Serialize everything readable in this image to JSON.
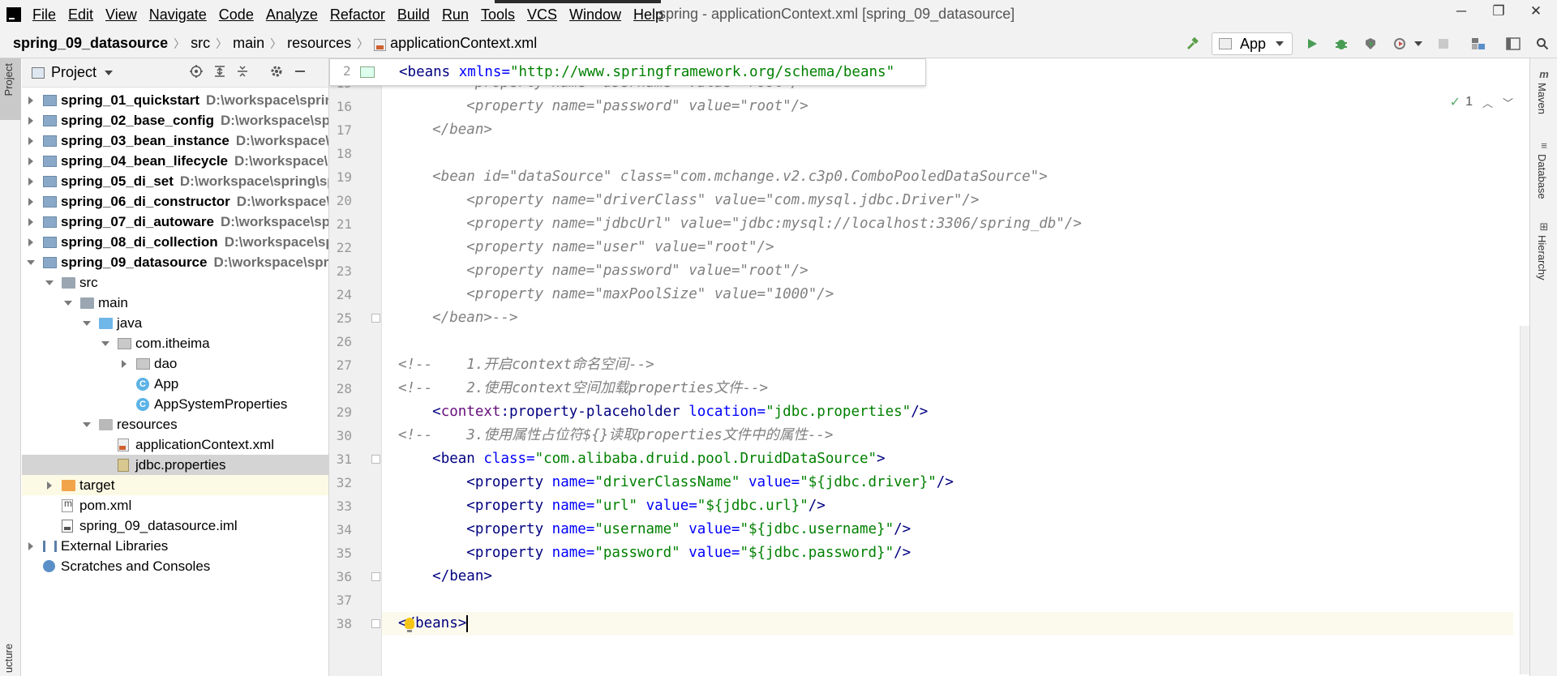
{
  "menu": {
    "items": [
      "File",
      "Edit",
      "View",
      "Navigate",
      "Code",
      "Analyze",
      "Refactor",
      "Build",
      "Run",
      "Tools",
      "VCS",
      "Window",
      "Help"
    ],
    "window_title": "spring - applicationContext.xml [spring_09_datasource]"
  },
  "window_controls": {
    "minimize": "─",
    "restore": "❐",
    "close": "✕"
  },
  "breadcrumb": {
    "items": [
      "spring_09_datasource",
      "src",
      "main",
      "resources",
      "applicationContext.xml"
    ],
    "separator": "〉"
  },
  "toolbar": {
    "run_config": "App",
    "icons": [
      "hammer-icon",
      "run-icon",
      "debug-icon",
      "coverage-icon",
      "profile-icon",
      "stop-icon",
      "project-structure-icon",
      "layout-icon",
      "search-icon"
    ]
  },
  "left_strip": {
    "project": "Project",
    "structure": "ucture"
  },
  "project_panel": {
    "title": "Project",
    "tree": [
      {
        "label": "spring_01_quickstart",
        "path": "D:\\workspace\\sprin",
        "depth": 0,
        "expand": "right",
        "icon": "module",
        "bold": true
      },
      {
        "label": "spring_02_base_config",
        "path": "D:\\workspace\\spri",
        "depth": 0,
        "expand": "right",
        "icon": "module",
        "bold": true
      },
      {
        "label": "spring_03_bean_instance",
        "path": "D:\\workspace\\s",
        "depth": 0,
        "expand": "right",
        "icon": "module",
        "bold": true
      },
      {
        "label": "spring_04_bean_lifecycle",
        "path": "D:\\workspace\\s",
        "depth": 0,
        "expand": "right",
        "icon": "module",
        "bold": true
      },
      {
        "label": "spring_05_di_set",
        "path": "D:\\workspace\\spring\\sp",
        "depth": 0,
        "expand": "right",
        "icon": "module",
        "bold": true
      },
      {
        "label": "spring_06_di_constructor",
        "path": "D:\\workspace\\s",
        "depth": 0,
        "expand": "right",
        "icon": "module",
        "bold": true
      },
      {
        "label": "spring_07_di_autoware",
        "path": "D:\\workspace\\spr",
        "depth": 0,
        "expand": "right",
        "icon": "module",
        "bold": true
      },
      {
        "label": "spring_08_di_collection",
        "path": "D:\\workspace\\sp",
        "depth": 0,
        "expand": "right",
        "icon": "module",
        "bold": true
      },
      {
        "label": "spring_09_datasource",
        "path": "D:\\workspace\\sprin",
        "depth": 0,
        "expand": "down",
        "icon": "module",
        "bold": true
      },
      {
        "label": "src",
        "path": "",
        "depth": 1,
        "expand": "down",
        "icon": "folder",
        "bold": false
      },
      {
        "label": "main",
        "path": "",
        "depth": 2,
        "expand": "down",
        "icon": "folder",
        "bold": false
      },
      {
        "label": "java",
        "path": "",
        "depth": 3,
        "expand": "down",
        "icon": "srcfolder",
        "bold": false
      },
      {
        "label": "com.itheima",
        "path": "",
        "depth": 4,
        "expand": "down",
        "icon": "package",
        "bold": false
      },
      {
        "label": "dao",
        "path": "",
        "depth": 5,
        "expand": "right",
        "icon": "package",
        "bold": false
      },
      {
        "label": "App",
        "path": "",
        "depth": 5,
        "expand": "none",
        "icon": "cls",
        "bold": false
      },
      {
        "label": "AppSystemProperties",
        "path": "",
        "depth": 5,
        "expand": "none",
        "icon": "cls",
        "bold": false
      },
      {
        "label": "resources",
        "path": "",
        "depth": 3,
        "expand": "down",
        "icon": "resfolder",
        "bold": false
      },
      {
        "label": "applicationContext.xml",
        "path": "",
        "depth": 4,
        "expand": "none",
        "icon": "xml",
        "bold": false
      },
      {
        "label": "jdbc.properties",
        "path": "",
        "depth": 4,
        "expand": "none",
        "icon": "props",
        "bold": false,
        "selected": true
      },
      {
        "label": "target",
        "path": "",
        "depth": 1,
        "expand": "right",
        "icon": "orange",
        "bold": false,
        "highlight": true
      },
      {
        "label": "pom.xml",
        "path": "",
        "depth": 1,
        "expand": "none",
        "icon": "maven",
        "bold": false
      },
      {
        "label": "spring_09_datasource.iml",
        "path": "",
        "depth": 1,
        "expand": "none",
        "icon": "iml",
        "bold": false
      },
      {
        "label": "External Libraries",
        "path": "",
        "depth": 0,
        "expand": "right",
        "icon": "libs",
        "bold": false
      },
      {
        "label": "Scratches and Consoles",
        "path": "",
        "depth": 0,
        "expand": "none",
        "icon": "scratch",
        "bold": false
      }
    ]
  },
  "editor": {
    "sticky": {
      "line": "2",
      "tokens": [
        [
          "tag",
          "<beans "
        ],
        [
          "attr",
          "xmlns="
        ],
        [
          "val",
          "\"http://www.springframework.org/schema/beans\""
        ]
      ]
    },
    "inspection": {
      "count": "1"
    },
    "lines": [
      {
        "n": "15",
        "tokens": [
          [
            "cmt",
            "        <property name=\"username\" value=\"root\"/>"
          ]
        ]
      },
      {
        "n": "16",
        "tokens": [
          [
            "cmt",
            "        <property name=\"password\" value=\"root\"/>"
          ]
        ]
      },
      {
        "n": "17",
        "tokens": [
          [
            "cmt",
            "    </bean>"
          ]
        ]
      },
      {
        "n": "18",
        "tokens": []
      },
      {
        "n": "19",
        "tokens": [
          [
            "cmt",
            "    <bean id=\"dataSource\" class=\"com.mchange.v2.c3p0.ComboPooledDataSource\">"
          ]
        ]
      },
      {
        "n": "20",
        "tokens": [
          [
            "cmt",
            "        <property name=\"driverClass\" value=\"com.mysql.jdbc.Driver\"/>"
          ]
        ]
      },
      {
        "n": "21",
        "tokens": [
          [
            "cmt",
            "        <property name=\"jdbcUrl\" value=\"jdbc:mysql://localhost:3306/spring_db\"/>"
          ]
        ]
      },
      {
        "n": "22",
        "tokens": [
          [
            "cmt",
            "        <property name=\"user\" value=\"root\"/>"
          ]
        ]
      },
      {
        "n": "23",
        "tokens": [
          [
            "cmt",
            "        <property name=\"password\" value=\"root\"/>"
          ]
        ]
      },
      {
        "n": "24",
        "tokens": [
          [
            "cmt",
            "        <property name=\"maxPoolSize\" value=\"1000\"/>"
          ]
        ]
      },
      {
        "n": "25",
        "tokens": [
          [
            "cmt",
            "    </bean>-->"
          ]
        ]
      },
      {
        "n": "26",
        "tokens": []
      },
      {
        "n": "27",
        "tokens": [
          [
            "cmt",
            "<!--    1.开启context命名空间-->"
          ]
        ]
      },
      {
        "n": "28",
        "tokens": [
          [
            "cmt",
            "<!--    2.使用context空间加载properties文件-->"
          ]
        ]
      },
      {
        "n": "29",
        "tokens": [
          [
            "text",
            "    "
          ],
          [
            "tag",
            "<"
          ],
          [
            "ns",
            "context"
          ],
          [
            "tag",
            ":property-placeholder "
          ],
          [
            "attr",
            "location="
          ],
          [
            "val",
            "\"jdbc.properties\""
          ],
          [
            "tag",
            "/>"
          ]
        ]
      },
      {
        "n": "30",
        "tokens": [
          [
            "cmt",
            "<!--    3.使用属性占位符${}读取properties文件中的属性-->"
          ]
        ]
      },
      {
        "n": "31",
        "tokens": [
          [
            "text",
            "    "
          ],
          [
            "tag",
            "<bean "
          ],
          [
            "attr",
            "class="
          ],
          [
            "val",
            "\"com.alibaba.druid.pool.DruidDataSource\""
          ],
          [
            "tag",
            ">"
          ]
        ]
      },
      {
        "n": "32",
        "tokens": [
          [
            "text",
            "        "
          ],
          [
            "tag",
            "<property "
          ],
          [
            "attr",
            "name="
          ],
          [
            "val",
            "\"driverClassName\" "
          ],
          [
            "attr",
            "value="
          ],
          [
            "val",
            "\"${jdbc.driver}\""
          ],
          [
            "tag",
            "/>"
          ]
        ]
      },
      {
        "n": "33",
        "tokens": [
          [
            "text",
            "        "
          ],
          [
            "tag",
            "<property "
          ],
          [
            "attr",
            "name="
          ],
          [
            "val",
            "\"url\" "
          ],
          [
            "attr",
            "value="
          ],
          [
            "val",
            "\"${jdbc.url}\""
          ],
          [
            "tag",
            "/>"
          ]
        ]
      },
      {
        "n": "34",
        "tokens": [
          [
            "text",
            "        "
          ],
          [
            "tag",
            "<property "
          ],
          [
            "attr",
            "name="
          ],
          [
            "val",
            "\"username\" "
          ],
          [
            "attr",
            "value="
          ],
          [
            "val",
            "\"${jdbc.username}\""
          ],
          [
            "tag",
            "/>"
          ]
        ]
      },
      {
        "n": "35",
        "tokens": [
          [
            "text",
            "        "
          ],
          [
            "tag",
            "<property "
          ],
          [
            "attr",
            "name="
          ],
          [
            "val",
            "\"password\" "
          ],
          [
            "attr",
            "value="
          ],
          [
            "val",
            "\"${jdbc.password}\""
          ],
          [
            "tag",
            "/>"
          ]
        ]
      },
      {
        "n": "36",
        "tokens": [
          [
            "text",
            "    "
          ],
          [
            "tag",
            "</bean>"
          ]
        ]
      },
      {
        "n": "37",
        "tokens": []
      },
      {
        "n": "38",
        "tokens": [
          [
            "tag",
            "</beans>"
          ]
        ],
        "caret": true
      }
    ]
  },
  "right_strip": {
    "maven": "Maven",
    "database": "Database",
    "hierarchy": "Hierarchy"
  }
}
